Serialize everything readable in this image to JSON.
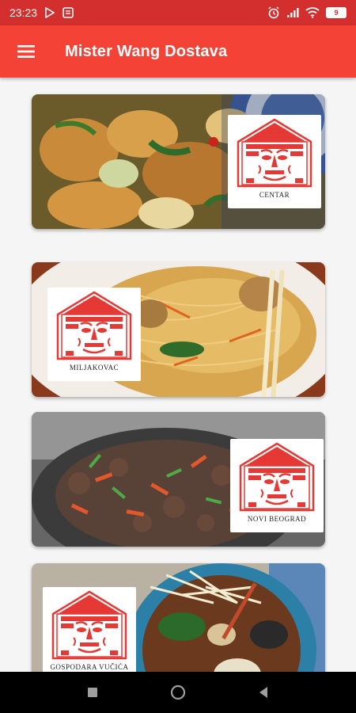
{
  "status_bar": {
    "time": "23:23",
    "battery": "9",
    "icons": [
      "play-store-icon",
      "notification-icon",
      "alarm-icon",
      "signal-icon",
      "wifi-icon",
      "battery-icon"
    ]
  },
  "app_bar": {
    "title": "Mister Wang Dostava",
    "menu_icon": "hamburger-menu-icon"
  },
  "restaurants": [
    {
      "label": "CENTAR",
      "logo_side": "right"
    },
    {
      "label": "MILJAKOVAC",
      "logo_side": "left"
    },
    {
      "label": "NOVI BEOGRAD",
      "logo_side": "right"
    },
    {
      "label": "GOSPODARA VUČIĆA",
      "logo_side": "left"
    }
  ],
  "nav_bar": {
    "buttons": [
      "recents-square-icon",
      "home-circle-icon",
      "back-triangle-icon"
    ]
  },
  "colors": {
    "primary": "#f44336",
    "primary_dark": "#d32f2f",
    "logo_red": "#e53935"
  }
}
